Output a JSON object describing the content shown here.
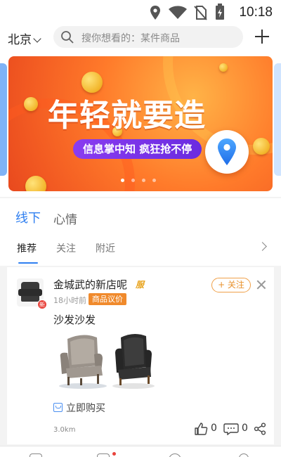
{
  "status_bar": {
    "time": "10:18",
    "icons": [
      "location-icon",
      "wifi-icon",
      "no-sim-icon",
      "battery-charging-icon"
    ]
  },
  "header": {
    "city": "北京",
    "search_placeholder": "搜你想看的：某件商品",
    "add_icon": "plus-icon"
  },
  "banner": {
    "headline": "年轻就要造",
    "tagline": "信息掌中知 疯狂抢不停",
    "slide_count": 4,
    "active_slide": 1,
    "colors": {
      "primary": "#f25a22",
      "accent": "#ffb347",
      "tagline_bg": "#7a34e8"
    }
  },
  "tabs": {
    "main": [
      {
        "label": "线下",
        "active": true
      },
      {
        "label": "心情",
        "active": false
      }
    ],
    "sub": [
      {
        "label": "推荐",
        "active": true
      },
      {
        "label": "关注",
        "active": false
      },
      {
        "label": "附近",
        "active": false
      }
    ]
  },
  "post": {
    "username": "金城武的新店呢",
    "user_badge": "服",
    "avatar_badge": "新",
    "time": "18小时前",
    "tag": "商品议价",
    "follow_label": "+ 关注",
    "text": "沙发沙发",
    "buy_label": "立即购买",
    "distance": "3.0km",
    "likes": "0",
    "comments": "0"
  },
  "colors": {
    "accent_blue": "#2f7ff0",
    "orange": "#f08a2c"
  }
}
